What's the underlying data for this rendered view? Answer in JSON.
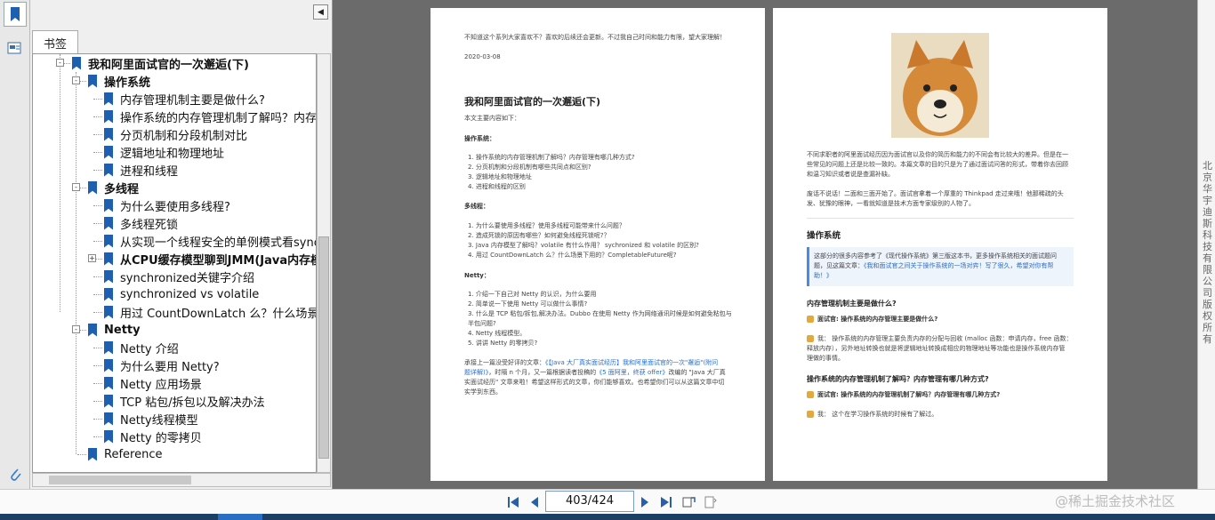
{
  "panel": {
    "tab_label": "书签",
    "tree": [
      {
        "label": "我和阿里面试官的一次邂逅(下)",
        "level": 0,
        "bold": true,
        "expander": "-"
      },
      {
        "label": "操作系统",
        "level": 1,
        "bold": true,
        "expander": "-"
      },
      {
        "label": "内存管理机制主要是做什么?",
        "level": 2
      },
      {
        "label": "操作系统的内存管理机制了解吗？内存管理",
        "level": 2
      },
      {
        "label": "分页机制和分段机制对比",
        "level": 2
      },
      {
        "label": "逻辑地址和物理地址",
        "level": 2
      },
      {
        "label": "进程和线程",
        "level": 2
      },
      {
        "label": "多线程",
        "level": 1,
        "bold": true,
        "expander": "-"
      },
      {
        "label": "为什么要使用多线程?",
        "level": 2
      },
      {
        "label": "多线程死锁",
        "level": 2
      },
      {
        "label": "从实现一个线程安全的单例模式看synchro",
        "level": 2
      },
      {
        "label": "从CPU缓存模型聊到JMM(Java内存模型",
        "level": 2,
        "bold": true,
        "expander": "+"
      },
      {
        "label": "synchronized关键字介绍",
        "level": 2
      },
      {
        "label": "synchronized vs volatile",
        "level": 2
      },
      {
        "label": "用过 CountDownLatch 么？什么场景下用",
        "level": 2
      },
      {
        "label": "Netty",
        "level": 1,
        "bold": true,
        "expander": "-"
      },
      {
        "label": "Netty 介绍",
        "level": 2
      },
      {
        "label": "为什么要用 Netty?",
        "level": 2
      },
      {
        "label": "Netty 应用场景",
        "level": 2
      },
      {
        "label": "TCP 粘包/拆包以及解决办法",
        "level": 2
      },
      {
        "label": "Netty线程模型",
        "level": 2
      },
      {
        "label": "Netty 的零拷贝",
        "level": 2
      },
      {
        "label": "Reference",
        "level": 1
      }
    ]
  },
  "left_page": {
    "intro": "不知道这个系列大家喜欢不？喜欢的后续还会更新。不过我自己时间和能力有限，望大家理解！",
    "date": "2020-03-08",
    "title": "我和阿里面试官的一次邂逅(下)",
    "subtitle": "本文主要内容如下：",
    "os_heading": "操作系统：",
    "os_items": [
      "1.  操作系统的内存管理机制了解吗？内存管理有哪几种方式?",
      "2.  分页机制和分段机制有哪些共同点和区别?",
      "3.  逻辑地址和物理地址",
      "4.  进程和线程的区别"
    ],
    "mt_heading": "多线程：",
    "mt_items": [
      "1.  为什么要使用多线程？使用多线程可能带来什么问题？",
      "2.  造成死锁的原因有哪些？如何避免线程死锁呢?？",
      "3.  Java 内存模型了解吗？volatile 有什么作用？ sychronized 和 volatile 的区别?",
      "4.  用过 CountDownLatch 么？什么场景下用的？CompletableFuture呢?"
    ],
    "netty_heading": "Netty：",
    "netty_items": [
      "1.  介绍一下自己对 Netty 的认识，为什么要用",
      "2.  简单说一下使用 Netty 可以做什么事情?",
      "3.  什么是 TCP 粘包/拆包,解决办法。Dubbo 在使用 Netty 作为网络通讯时候是如何避免粘包与",
      "     半包问题?",
      "4.  Netty 线程模型。",
      "5.  讲讲 Netty 的零拷贝?"
    ],
    "outro_1": "承接上一篇没受好评的文章：",
    "outro_link_1": "《【Java 大厂真实面试经历】我和阿里面试官的一次\"邂逅\"(附问",
    "outro_link_2": "题详解)》",
    "outro_2": "，时隔 n 个月，又一篇根据读者投稿的",
    "outro_link_3": "《5 面阿里，终获 offer》",
    "outro_3": "改编的 \"Java 大厂真",
    "outro_4": "实面试经历\" 文章来啦！希望这样形式的文章，你们能够喜欢。也希望你们可以从这篇文章中切",
    "outro_5": "实学到东西。"
  },
  "right_page": {
    "para1_l1": "不同求职者的阿里面试经历因为面试官以及你的简历和能力的不同会有比较大的差异。但是在一",
    "para1_l2": "些常见的问题上还是比较一致的。本篇文章的目的只是为了通过面试问答的形式，带着你去回顾",
    "para1_l3": "和温习知识或者说是查漏补缺。",
    "para2_l1": "废话不说话！二面和三面开始了。面试官拿着一个厚重的 Thinkpad 走过来哦！他那稀疏的头",
    "para2_l2": "发、犹豫的眼神，一看就知道是技术方面专家级别的人物了。",
    "os_title": "操作系统",
    "quote_l1": "这部分的很多内容参考了《现代操作系统》第三版这本书，更多操作系统相关的面试题问",
    "quote_l2": "题，见这篇文章：",
    "quote_link_l2": "《我和面试官之间关于操作系统的一场对弈！写了很久，希望对你有帮",
    "quote_link_l3": "助！》",
    "q1_title": "内存管理机制主要是做什么?",
    "q1_interviewer": "面试官: 操作系统的内存管理主要是做什么?",
    "q1_me_l1": "我：  操作系统的内存管理主要负责内存的分配与回收 (malloc 函数：申请内存，free 函数：",
    "q1_me_l2": "释放内存），另外地址转换也就是将逻辑地址转换成相应的物理地址等功能也是操作系统内存管",
    "q1_me_l3": "理做的事情。",
    "q2_title": "操作系统的内存管理机制了解吗？内存管理有哪几种方式?",
    "q2_interviewer": "面试官: 操作系统的内存管理机制了解吗？内存管理有哪几种方式?",
    "q2_me": "我：  这个在学习操作系统的时候有了解过。"
  },
  "sidebar_right_text": "北京华宇迪斯科技有限公司版权所有",
  "toolbar": {
    "page_indicator": "403/424",
    "watermark": "@稀土掘金技术社区"
  },
  "colors": {
    "bookmark_blue": "#1f5fb0",
    "link_blue": "#2a6dc9",
    "doc_background": "#6b6b6b"
  },
  "icons": [
    "bookmark-icon",
    "thumbnail-icon",
    "attachment-icon",
    "collapse-panel-icon",
    "first-page-icon",
    "prev-page-icon",
    "next-page-icon",
    "last-page-icon",
    "rotate-icon",
    "fit-icon"
  ]
}
